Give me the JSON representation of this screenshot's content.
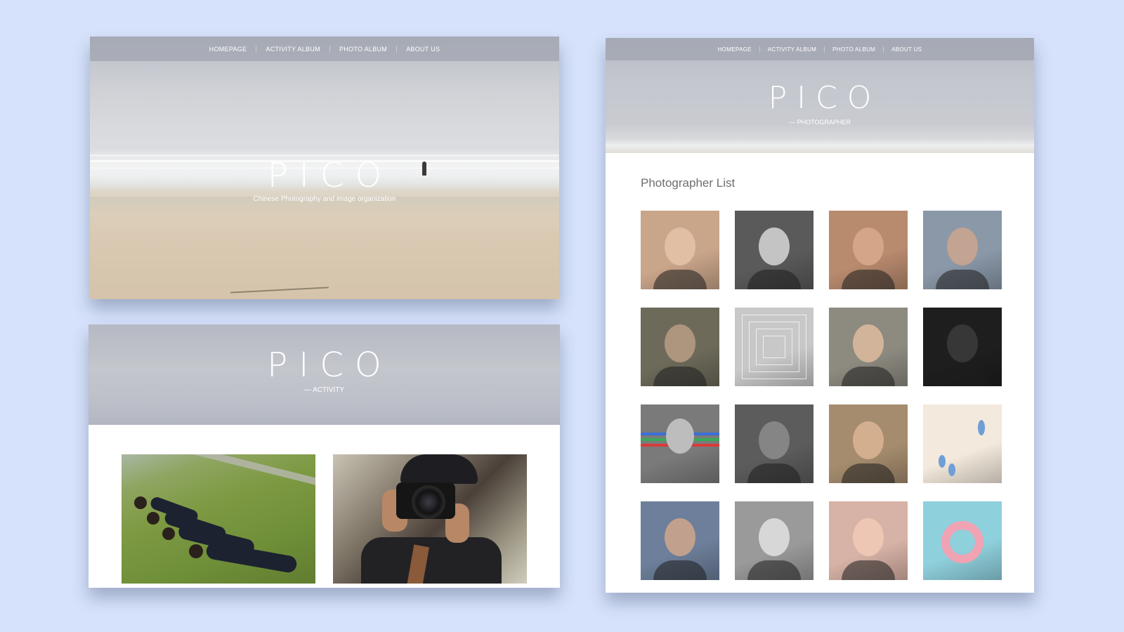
{
  "nav": {
    "items": [
      {
        "label": "HOMEPAGE"
      },
      {
        "label": "ACTIVITY ALBUM"
      },
      {
        "label": "PHOTO ALBUM"
      },
      {
        "label": "ABOUT US"
      }
    ]
  },
  "home": {
    "title": "PICO",
    "subtitle": "Chinese Photography and image organization"
  },
  "activity": {
    "title": "PICO",
    "subtitle": "— ACTIVITY",
    "photos": [
      {
        "icon": "group-lying-on-grass-photo"
      },
      {
        "icon": "photographer-with-camera-photo"
      }
    ]
  },
  "photographer": {
    "title": "PICO",
    "subtitle": "— PHOTOGRAPHER",
    "list_heading": "Photographer List",
    "thumbnails": [
      {
        "icon": "portrait-woman-earring",
        "color": "#c9a58a"
      },
      {
        "icon": "portrait-woman-bw",
        "color": "#5a5a5a"
      },
      {
        "icon": "portrait-man-selfie",
        "color": "#b88a6e"
      },
      {
        "icon": "portrait-woman-window",
        "color": "#8a98a8"
      },
      {
        "icon": "man-with-headphones",
        "color": "#6d6a5a"
      },
      {
        "icon": "mirror-corridor",
        "color": "#c8c8c8"
      },
      {
        "icon": "woman-by-tree",
        "color": "#8d8a80"
      },
      {
        "icon": "dark-mirror-selfie",
        "color": "#1e1e1e"
      },
      {
        "icon": "man-rgb-lines",
        "color": "#7a7a7a"
      },
      {
        "icon": "camera-street-bw",
        "color": "#5c5c5c"
      },
      {
        "icon": "woman-street-pole",
        "color": "#a58c6e"
      },
      {
        "icon": "blue-drops-minimal",
        "color": "#f3e9dc"
      },
      {
        "icon": "woman-hat-camera",
        "color": "#6d7f9a"
      },
      {
        "icon": "man-portrait-bw",
        "color": "#9a9a9a"
      },
      {
        "icon": "woman-yellow-dress",
        "color": "#d7b2a6"
      },
      {
        "icon": "pool-pink-float",
        "color": "#8fd0dd"
      }
    ]
  }
}
